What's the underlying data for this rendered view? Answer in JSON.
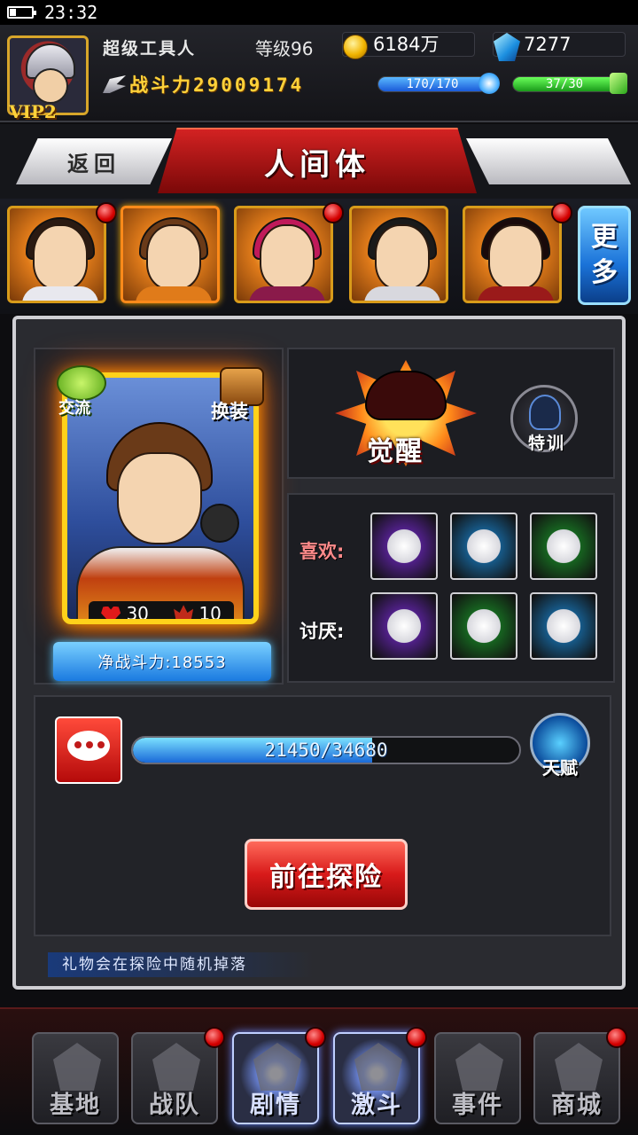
{
  "status": {
    "time": "23:32"
  },
  "player": {
    "vip": "VIP2",
    "name": "超级工具人",
    "level": "等级96",
    "gold": "6184万",
    "gems": "7277",
    "combat_power": "战斗力29009174",
    "stamina": {
      "text": "170/170",
      "fraction": 1.0
    },
    "energy": {
      "text": "37/30",
      "fraction": 1.0
    }
  },
  "nav_top": {
    "back": "返回",
    "title": "人间体"
  },
  "roster": {
    "more": [
      "更",
      "多"
    ],
    "cards": [
      {
        "name": "heroine-white-suit",
        "hair": "#2a1a12",
        "body": "#e8e8ee",
        "badge": true,
        "selected": false
      },
      {
        "name": "hero-brown-hair",
        "hair": "#6a3a18",
        "body": "#e07b1a",
        "badge": false,
        "selected": true
      },
      {
        "name": "alien-pink-monster",
        "hair": "#c01a5a",
        "body": "#8a1a4a",
        "badge": true,
        "selected": false
      },
      {
        "name": "boy-black-hair",
        "hair": "#1a1a1a",
        "body": "#d8d8de",
        "badge": false,
        "selected": false
      },
      {
        "name": "woman-long-hair",
        "hair": "#1a0a0a",
        "body": "#9a1a1a",
        "badge": true,
        "selected": false
      }
    ]
  },
  "character": {
    "chat_label": "交流",
    "outfit_label": "换装",
    "hp": "30",
    "affinity": "10",
    "net_power": "净战斗力:18553"
  },
  "awaken": {
    "label": "觉醒",
    "train_label": "特训"
  },
  "preferences": {
    "likes_label": "喜欢:",
    "dislikes_label": "讨厌:",
    "likes": [
      {
        "name": "armored-glove",
        "color": "#7a2ad8"
      },
      {
        "name": "curry-plate",
        "color": "#1a8ad8"
      },
      {
        "name": "red-book",
        "color": "#1a9a2a"
      }
    ],
    "dislikes": [
      {
        "name": "white-scarf",
        "color": "#7a2ad8"
      },
      {
        "name": "red-flower",
        "color": "#1a9a2a"
      },
      {
        "name": "blue-ring",
        "color": "#1a8ad8"
      }
    ]
  },
  "exp": {
    "text": "21450/34680",
    "current": 21450,
    "max": 34680
  },
  "talent_label": "天赋",
  "go_button": "前往探险",
  "hint": "礼物会在探险中随机掉落",
  "bottom_nav": [
    {
      "label": "基地",
      "badge": false,
      "active": false
    },
    {
      "label": "战队",
      "badge": true,
      "active": false
    },
    {
      "label": "剧情",
      "badge": true,
      "active": true
    },
    {
      "label": "激斗",
      "badge": true,
      "active": true
    },
    {
      "label": "事件",
      "badge": false,
      "active": false
    },
    {
      "label": "商城",
      "badge": true,
      "active": false
    }
  ]
}
